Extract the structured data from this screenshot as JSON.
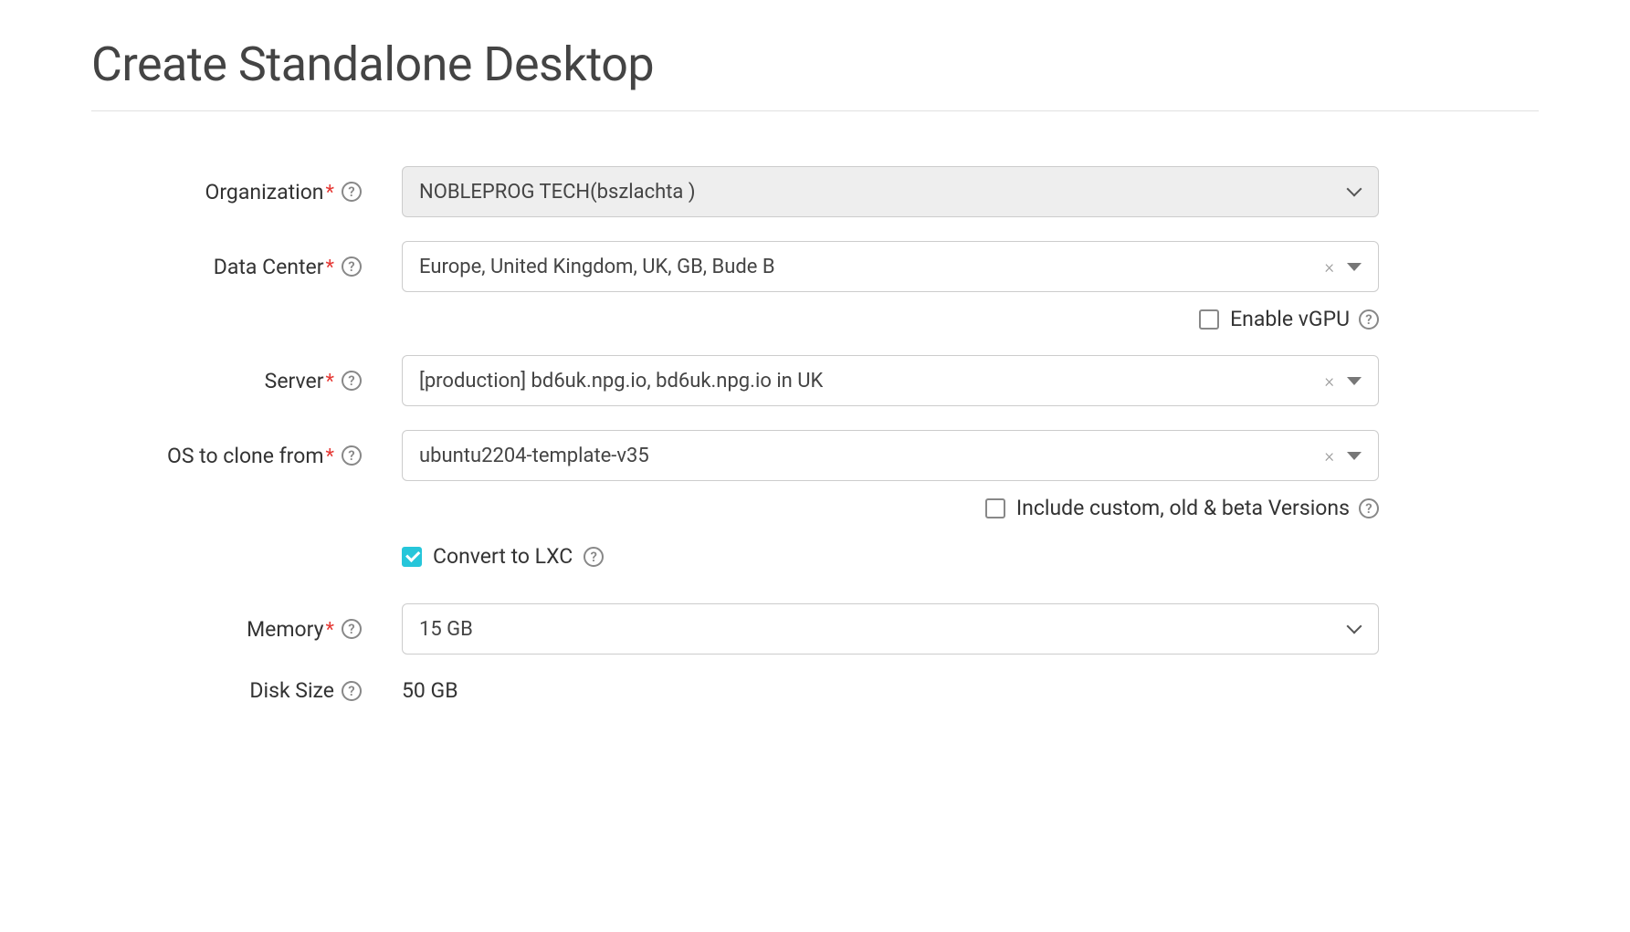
{
  "page": {
    "title": "Create Standalone Desktop"
  },
  "form": {
    "organization": {
      "label": "Organization",
      "required": true,
      "value": "NOBLEPROG TECH(bszlachta )"
    },
    "dataCenter": {
      "label": "Data Center",
      "required": true,
      "value": "Europe, United Kingdom, UK, GB, Bude B"
    },
    "enableVgpu": {
      "label": "Enable vGPU",
      "checked": false
    },
    "server": {
      "label": "Server",
      "required": true,
      "value": "[production] bd6uk.npg.io, bd6uk.npg.io in UK"
    },
    "osClone": {
      "label": "OS to clone from",
      "required": true,
      "value": "ubuntu2204-template-v35"
    },
    "includeBeta": {
      "label": "Include custom, old & beta Versions",
      "checked": false
    },
    "convertLxc": {
      "label": "Convert to LXC",
      "checked": true
    },
    "memory": {
      "label": "Memory",
      "required": true,
      "value": "15 GB"
    },
    "diskSize": {
      "label": "Disk Size",
      "required": false,
      "value": "50 GB"
    }
  }
}
